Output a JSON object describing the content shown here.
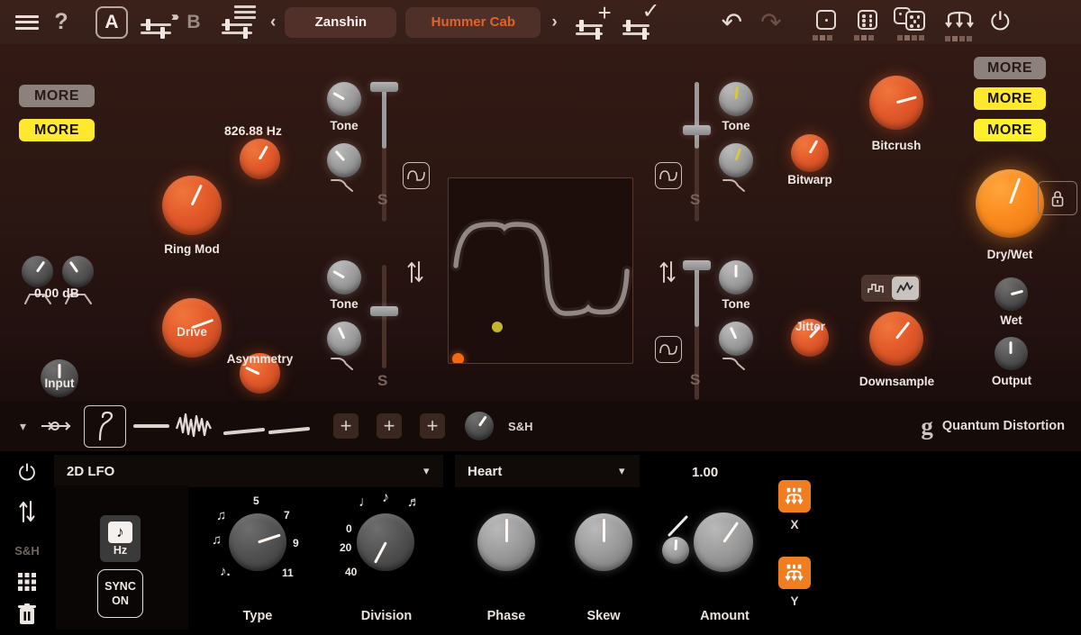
{
  "toolbar": {
    "menu_icon": "hamburger-icon",
    "help_label": "?",
    "slot_a_label": "A",
    "slot_b_label": "B",
    "copy_icon": "copy-settings-icon",
    "settings_icon": "slider-menu-icon",
    "prev_label": "‹",
    "next_label": "›",
    "preset_bank": "Zanshin",
    "preset_name": "Hummer Cab",
    "add_preset_icon": "add-preset-icon",
    "save_preset_icon": "confirm-preset-icon",
    "undo_label": "↶",
    "redo_label": "↷",
    "randomize_one_icon": "dice-one-icon",
    "randomize_all_icon": "dice-six-icon",
    "randomize_double_icon": "double-dice-icon",
    "morph_icon": "trident-morph-icon",
    "power_icon": "power-icon"
  },
  "main": {
    "more_chips": [
      {
        "label": "MORE",
        "style": "grey"
      },
      {
        "label": "MORE",
        "style": "yellow"
      }
    ],
    "more_chips_right": [
      {
        "label": "MORE",
        "style": "grey"
      },
      {
        "label": "MORE",
        "style": "yellow"
      },
      {
        "label": "MORE",
        "style": "yellow2"
      }
    ],
    "ringmod_freq": "826.88 Hz",
    "input_db": "0.00 dB",
    "knobs": {
      "ring_mod": "Ring Mod",
      "drive": "Drive",
      "asymmetry": "Asymmetry",
      "input": "Input",
      "tone1": "Tone",
      "tone2": "Tone",
      "tone3": "Tone",
      "tone4": "Tone",
      "bitwarp": "Bitwarp",
      "jitter": "Jitter",
      "bitcrush": "Bitcrush",
      "downsample": "Downsample",
      "drywet": "Dry/Wet",
      "wet": "Wet",
      "output": "Output"
    },
    "slider_labels": {
      "s1": "S",
      "s2": "S",
      "s3": "S",
      "s4": "S"
    },
    "lock_icon": "lock-icon",
    "downsample_mode": {
      "stepped": "stepped-wave-icon",
      "smooth": "smooth-wave-icon",
      "selected": "smooth"
    },
    "waveform_display": {
      "name": "transfer-curve-display",
      "dot_orange": "drag-point-orange",
      "dot_yellow": "drag-point-yellow"
    }
  },
  "modstrip": {
    "expand_icon": "chevron-down-icon",
    "route_icon": "modulation-route-icon",
    "lfo_shape_icon": "lfo-curve-icon",
    "line_icon_1": "flat-line-icon",
    "noise_icon": "noise-wave-icon",
    "line_icon_2": "ramp-line-icon",
    "line_icon_3": "ramp-line-icon",
    "add_slots": [
      "+",
      "+",
      "+"
    ],
    "sh_label": "S&H",
    "brand_logo": "g",
    "brand_name": "Quantum Distortion"
  },
  "bottom": {
    "sidebar": [
      {
        "name": "power-icon",
        "label": ""
      },
      {
        "name": "bipolar-icon",
        "label": ""
      },
      {
        "name": "sh-label",
        "label": "S&H"
      },
      {
        "name": "grid-icon",
        "label": ""
      },
      {
        "name": "trash-icon",
        "label": ""
      }
    ],
    "source_dropdown": "2D LFO",
    "shape_dropdown": "Heart",
    "rate_value": "1.00",
    "hz_button": {
      "note_glyph": "♪",
      "label": "Hz"
    },
    "sync_button": {
      "line1": "SYNC",
      "line2": "ON"
    },
    "type_knob": {
      "label": "Type",
      "ticks": [
        "♫",
        "5",
        "7",
        "9",
        "11",
        "♪.",
        "♫"
      ]
    },
    "division_knob": {
      "label": "Division",
      "ticks": [
        "♩",
        "♪",
        "♬",
        "0",
        "20",
        "40"
      ]
    },
    "phase_knob": "Phase",
    "skew_knob": "Skew",
    "amount_knob": "Amount",
    "xy_buttons": [
      {
        "label": "X",
        "icon": "trident-assign-icon"
      },
      {
        "label": "Y",
        "icon": "trident-assign-icon"
      }
    ]
  },
  "colors": {
    "accent_orange": "#e2592a",
    "bright_orange": "#fb8a1e",
    "yellow": "#ffe92e",
    "panel_bg": "#2c1712",
    "bottom_bg": "#000000"
  }
}
